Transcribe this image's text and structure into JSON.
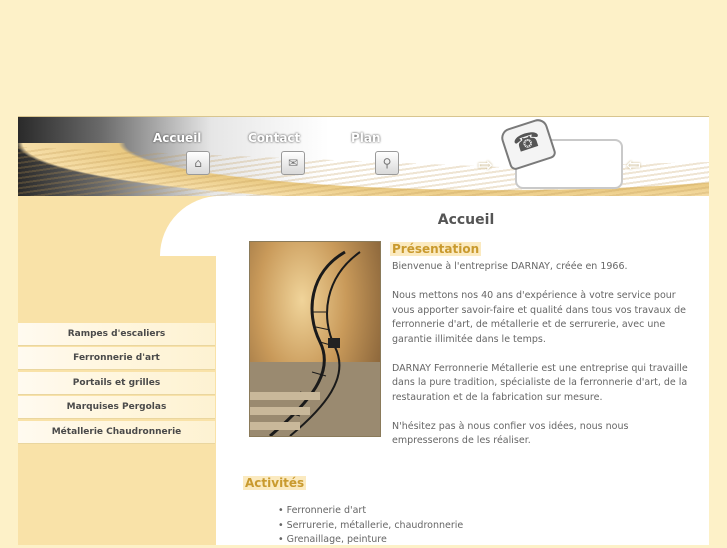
{
  "nav": {
    "items": [
      {
        "label": "Accueil",
        "icon": "home-icon"
      },
      {
        "label": "Contact",
        "icon": "mail-icon"
      },
      {
        "label": "Plan",
        "icon": "search-icon"
      }
    ]
  },
  "sidebar": {
    "items": [
      {
        "label": "Rampes d'escaliers"
      },
      {
        "label": "Ferronnerie d'art"
      },
      {
        "label": "Portails et grilles"
      },
      {
        "label": "Marquises Pergolas"
      },
      {
        "label": "Métallerie Chaudronnerie"
      }
    ]
  },
  "main": {
    "title": "Accueil",
    "presentation": {
      "heading": "Présentation",
      "paragraphs": [
        "Bienvenue à l'entreprise DARNAY, créée en 1966.",
        "Nous mettons nos 40 ans d'expérience à votre service pour vous apporter savoir-faire et qualité dans tous vos travaux de ferronnerie d'art, de métallerie et de serrurerie, avec une garantie illimitée dans le temps.",
        "DARNAY Ferronnerie Métallerie est une entreprise qui travaille dans la pure tradition, spécialiste de la ferronnerie d'art, de la restauration et de la fabrication sur mesure.",
        "N'hésitez pas à nous confier vos idées, nous nous empresserons de les réaliser."
      ]
    },
    "activities": {
      "heading": "Activités",
      "items": [
        "• Ferronnerie d'art",
        "• Serrurerie, métallerie, chaudronnerie",
        "• Grenaillage, peinture"
      ]
    }
  },
  "colors": {
    "background": "#fdf1c8",
    "sidebar": "#f9e2a8",
    "accent": "#c99a2e"
  }
}
